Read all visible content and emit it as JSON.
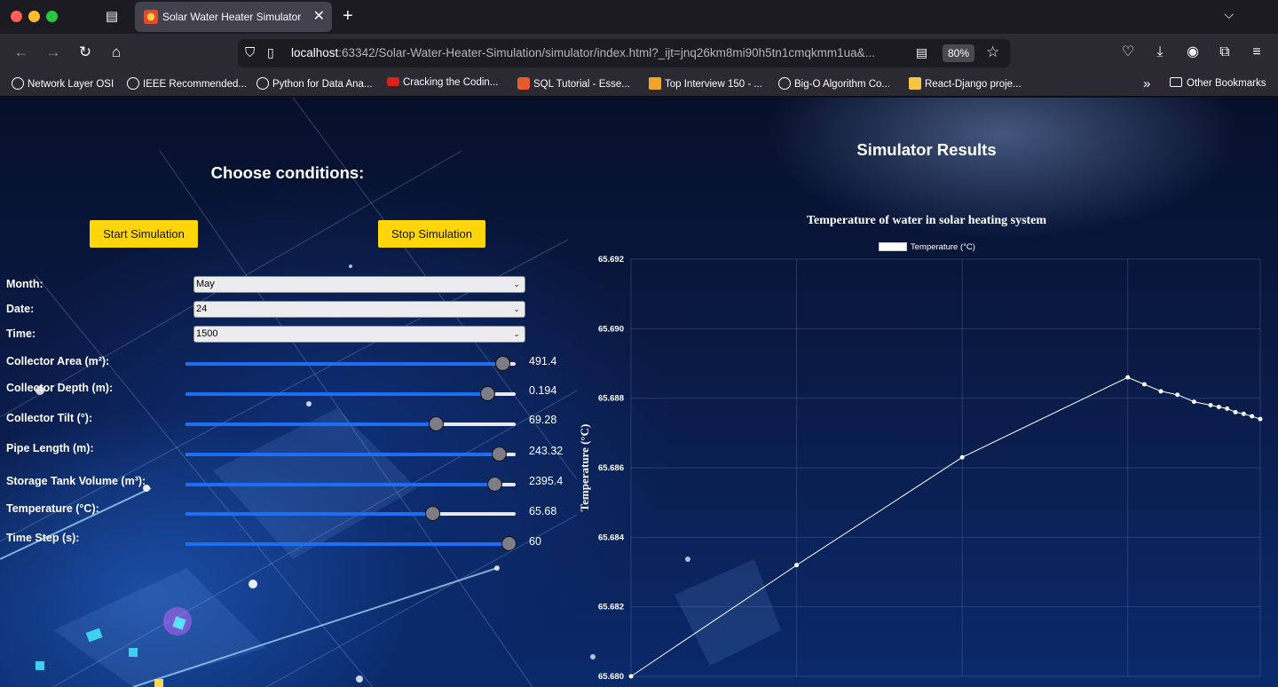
{
  "browser": {
    "tab_title": "Solar Water Heater Simulator",
    "url_host": "localhost",
    "url_rest": ":63342/Solar-Water-Heater-Simulation/simulator/index.html?_ijt=jnq26km8mi90h5tn1cmqkmm1ua&...",
    "zoom": "80%",
    "bookmarks": [
      {
        "label": "Network Layer OSI",
        "icon": "globe-icon"
      },
      {
        "label": "IEEE Recommended...",
        "icon": "globe-icon"
      },
      {
        "label": "Python for Data Ana...",
        "icon": "globe-icon"
      },
      {
        "label": "Cracking the Codin...",
        "icon": "youtube-icon"
      },
      {
        "label": "SQL Tutorial - Esse...",
        "icon": "s-logo-icon"
      },
      {
        "label": "Top Interview 150 - ...",
        "icon": "leetcode-icon"
      },
      {
        "label": "Big-O Algorithm Co...",
        "icon": "globe-icon"
      },
      {
        "label": "React-Django proje...",
        "icon": "image-icon"
      }
    ],
    "other_bookmarks": "Other Bookmarks"
  },
  "controls": {
    "heading": "Choose conditions:",
    "start_label": "Start Simulation",
    "stop_label": "Stop Simulation",
    "month": {
      "label": "Month:",
      "value": "May"
    },
    "date": {
      "label": "Date:",
      "value": "24"
    },
    "time": {
      "label": "Time:",
      "value": "1500"
    },
    "sliders": [
      {
        "label": "Collector Area (m²):",
        "value": "491.4",
        "fraction": 0.96
      },
      {
        "label": "Collector Depth (m):",
        "value": "0.194",
        "fraction": 0.915
      },
      {
        "label": "Collector Tilt (°):",
        "value": "69.28",
        "fraction": 0.757
      },
      {
        "label": "Pipe Length (m):",
        "value": "243.32",
        "fraction": 0.949
      },
      {
        "label": "Storage Tank Volume (m³):",
        "value": "2395.4",
        "fraction": 0.935
      },
      {
        "label": "Temperature (°C):",
        "value": "65.68",
        "fraction": 0.747
      },
      {
        "label": "Time Step (s):",
        "value": "60",
        "fraction": 0.978
      }
    ]
  },
  "results": {
    "heading": "Simulator Results",
    "chart_data": {
      "type": "line",
      "title": "Temperature of water in solar heating system",
      "ylabel": "Temperature (°C)",
      "xlabel": "",
      "ylim": [
        65.68,
        65.692
      ],
      "yticks": [
        "65.692",
        "65.690",
        "65.688",
        "65.686",
        "65.684",
        "65.682",
        "65.680"
      ],
      "grid": true,
      "legend_position": "top-center",
      "series": [
        {
          "name": "Temperature (°C)",
          "color": "#ffffff",
          "points": [
            {
              "x": 0,
              "y": 65.68
            },
            {
              "x": 1,
              "y": 65.6832
            },
            {
              "x": 2,
              "y": 65.6863
            },
            {
              "x": 3,
              "y": 65.6886
            },
            {
              "x": 3.1,
              "y": 65.6884
            },
            {
              "x": 3.2,
              "y": 65.6882
            },
            {
              "x": 3.3,
              "y": 65.6881
            },
            {
              "x": 3.4,
              "y": 65.6879
            },
            {
              "x": 3.5,
              "y": 65.6878
            },
            {
              "x": 3.55,
              "y": 65.68775
            },
            {
              "x": 3.6,
              "y": 65.6877
            },
            {
              "x": 3.65,
              "y": 65.6876
            },
            {
              "x": 3.7,
              "y": 65.68755
            },
            {
              "x": 3.75,
              "y": 65.68748
            },
            {
              "x": 3.8,
              "y": 65.6874
            }
          ]
        }
      ]
    }
  }
}
